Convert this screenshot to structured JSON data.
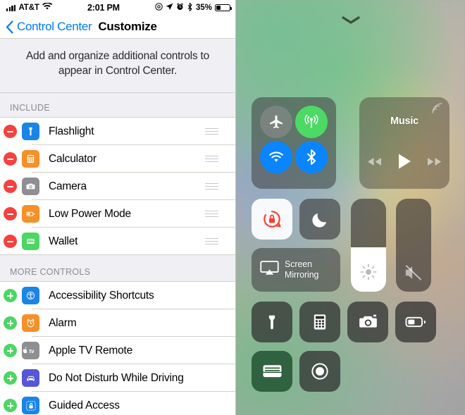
{
  "status_bar": {
    "carrier": "AT&T",
    "time": "2:01 PM",
    "battery_percent": "35%",
    "icons": [
      "signal-bars-icon",
      "wifi-icon",
      "do-not-disturb-icon",
      "location-arrow-icon",
      "alarm-clock-icon",
      "bluetooth-icon",
      "battery-icon"
    ]
  },
  "nav": {
    "back_label": "Control Center",
    "title": "Customize"
  },
  "blurb": "Add and organize additional controls to appear in Control Center.",
  "sections": [
    {
      "header": "INCLUDE",
      "rows": [
        {
          "label": "Flashlight",
          "icon": "flashlight-icon",
          "icon_color": "#1a84e8",
          "action": "remove"
        },
        {
          "label": "Calculator",
          "icon": "calculator-icon",
          "icon_color": "#f79028",
          "action": "remove"
        },
        {
          "label": "Camera",
          "icon": "camera-icon",
          "icon_color": "#8e8e93",
          "action": "remove"
        },
        {
          "label": "Low Power Mode",
          "icon": "low-power-icon",
          "icon_color": "#f79028",
          "action": "remove"
        },
        {
          "label": "Wallet",
          "icon": "wallet-icon",
          "icon_color": "#4cd663",
          "action": "remove"
        }
      ]
    },
    {
      "header": "MORE CONTROLS",
      "rows": [
        {
          "label": "Accessibility Shortcuts",
          "icon": "accessibility-icon",
          "icon_color": "#1a84e8",
          "action": "add"
        },
        {
          "label": "Alarm",
          "icon": "alarm-clock-icon",
          "icon_color": "#f79028",
          "action": "add"
        },
        {
          "label": "Apple TV Remote",
          "icon": "apple-tv-icon",
          "icon_color": "#8e8e93",
          "action": "add"
        },
        {
          "label": "Do Not Disturb While Driving",
          "icon": "car-icon",
          "icon_color": "#5756d6",
          "action": "add"
        },
        {
          "label": "Guided Access",
          "icon": "guided-access-icon",
          "icon_color": "#1a84e8",
          "action": "add"
        }
      ]
    }
  ],
  "control_center": {
    "grabber": "chevron-down-grabber",
    "connectivity": {
      "airplane_mode": {
        "name": "airplane-mode-toggle",
        "state": "off",
        "color": "#8c8c8c"
      },
      "cellular_data": {
        "name": "cellular-data-toggle",
        "state": "on",
        "color": "#4cd964"
      },
      "wifi": {
        "name": "wifi-toggle",
        "state": "on",
        "color": "#0a84ff"
      },
      "bluetooth": {
        "name": "bluetooth-toggle",
        "state": "on",
        "color": "#0a84ff"
      }
    },
    "music": {
      "title": "Music",
      "airplay": "airplay-icon",
      "prev": "rewind-icon",
      "play": "play-icon",
      "next": "fast-forward-icon"
    },
    "rotation_lock": {
      "label": "rotation-lock-toggle",
      "state": "on"
    },
    "do_not_disturb": {
      "label": "do-not-disturb-toggle",
      "state": "off"
    },
    "screen_mirroring": {
      "line1": "Screen",
      "line2": "Mirroring"
    },
    "brightness": {
      "name": "brightness-slider",
      "value": 48
    },
    "volume": {
      "name": "volume-slider",
      "value": 0,
      "muted": true
    },
    "shortcuts": [
      {
        "name": "flashlight-tile",
        "icon": "flashlight-icon"
      },
      {
        "name": "calculator-tile",
        "icon": "calculator-icon"
      },
      {
        "name": "camera-tile",
        "icon": "camera-icon"
      },
      {
        "name": "low-power-mode-tile",
        "icon": "low-power-icon"
      },
      {
        "name": "wallet-tile",
        "icon": "wallet-icon"
      },
      {
        "name": "screen-recording-tile",
        "icon": "record-icon"
      }
    ]
  }
}
